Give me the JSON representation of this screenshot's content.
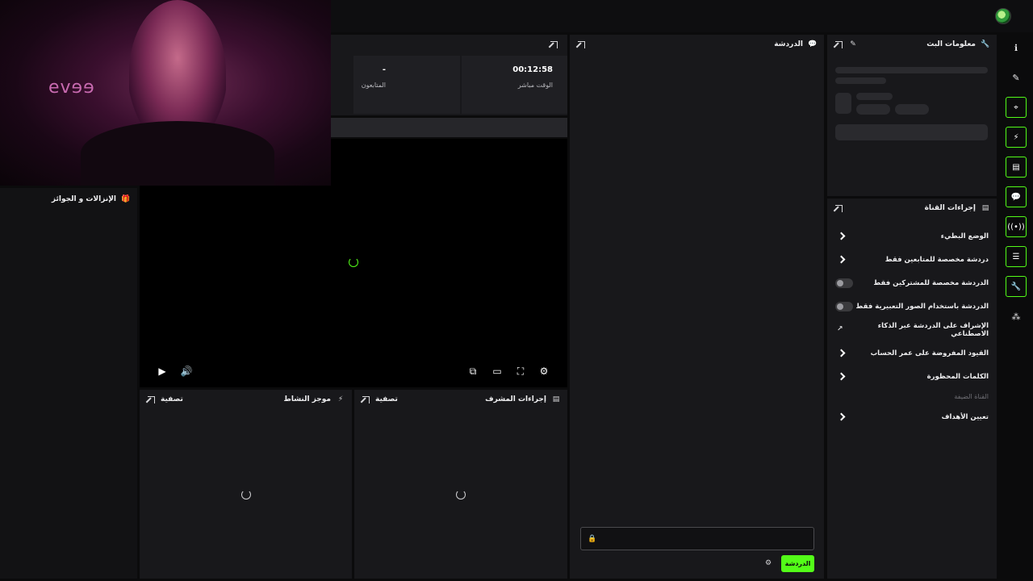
{
  "webcam": {
    "logo_text": "evɘɘ"
  },
  "stream_stats": {
    "uptime_value": "00:12:58",
    "uptime_label": "الوقت مباشر",
    "viewers_value": "-",
    "viewers_label": "المتابعون"
  },
  "chat": {
    "title": "الدردشة",
    "send_label": "الدردشة",
    "input_placeholder": ""
  },
  "stream_info": {
    "title": "معلومات البث"
  },
  "channel_actions": {
    "title": "إجراءات القناة",
    "items": [
      {
        "label": "الوضع البطيء",
        "control": "chevron"
      },
      {
        "label": "دردشة مخصصة للمتابعين فقط",
        "control": "chevron"
      },
      {
        "label": "الدردشة مخصصة للمشتركين فقط",
        "control": "toggle",
        "value": false
      },
      {
        "label": "الدردشة باستخدام الصور التعبيرية فقط",
        "control": "toggle",
        "value": false
      },
      {
        "label": "الإشراف على الدردشة عبر الذكاء الاصطناعي",
        "control": "external"
      },
      {
        "label": "القيود المفروضة على عمر الحساب",
        "control": "chevron"
      },
      {
        "label": "الكلمات المحظورة",
        "control": "chevron"
      }
    ],
    "section_label": "القناة الضيفة",
    "goals_label": "تعيين الأهداف"
  },
  "rewards": {
    "title": "الإنزالات و الجوائز"
  },
  "activity_feed": {
    "title": "موجز النشاط",
    "filter_label": "تصفية"
  },
  "mod_actions": {
    "title": "إجراءات المشرف",
    "filter_label": "تصفية"
  },
  "colors": {
    "accent": "#53fc18",
    "panel": "#18181b",
    "background": "#0b0b0c"
  }
}
